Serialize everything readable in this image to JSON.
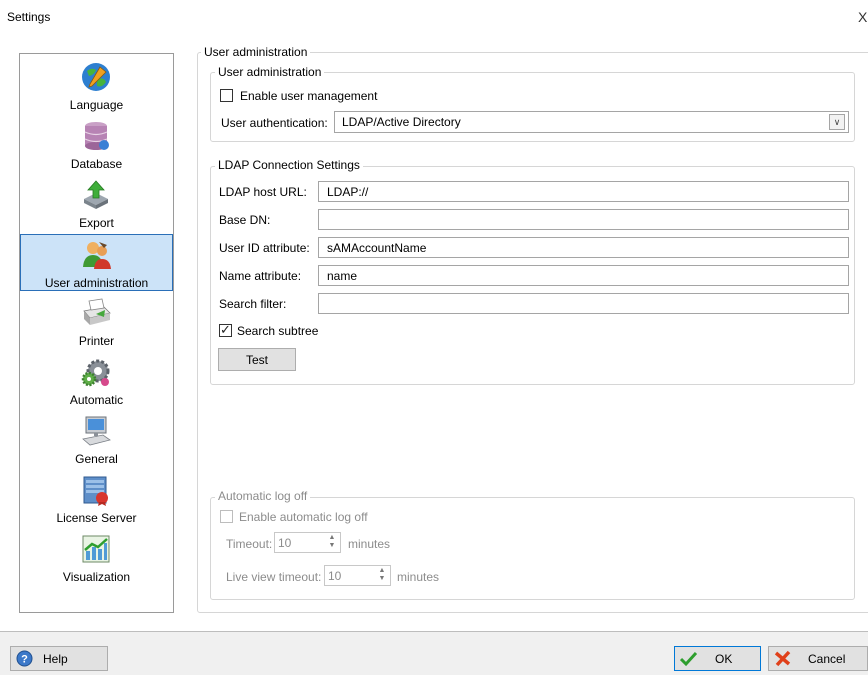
{
  "window": {
    "title": "Settings",
    "close_glyph": "X"
  },
  "nav": {
    "items": [
      {
        "label": "Language",
        "icon": "globe-icon"
      },
      {
        "label": "Database",
        "icon": "database-icon"
      },
      {
        "label": "Export",
        "icon": "export-icon"
      },
      {
        "label": "User administration",
        "icon": "users-icon",
        "selected": true
      },
      {
        "label": "Printer",
        "icon": "printer-icon"
      },
      {
        "label": "Automatic",
        "icon": "gears-icon"
      },
      {
        "label": "General",
        "icon": "computer-icon"
      },
      {
        "label": "License Server",
        "icon": "license-server-icon"
      },
      {
        "label": "Visualization",
        "icon": "chart-icon"
      }
    ]
  },
  "main": {
    "outer_legend": "User administration",
    "user_admin": {
      "legend": "User administration",
      "enable_label": "Enable user management",
      "enable_checked": false,
      "auth_label": "User authentication:",
      "auth_value": "LDAP/Active Directory"
    },
    "ldap": {
      "legend": "LDAP Connection Settings",
      "host_label": "LDAP host URL:",
      "host_value": "LDAP://",
      "base_dn_label": "Base DN:",
      "base_dn_value": "",
      "userid_label": "User ID attribute:",
      "userid_value": "sAMAccountName",
      "name_label": "Name attribute:",
      "name_value": "name",
      "filter_label": "Search filter:",
      "filter_value": "",
      "subtree_label": "Search subtree",
      "subtree_checked": true,
      "test_label": "Test"
    },
    "logoff": {
      "legend": "Automatic log off",
      "enable_label": "Enable automatic log off",
      "timeout_label": "Timeout:",
      "timeout_value": "10",
      "timeout_unit": "minutes",
      "live_label": "Live view timeout:",
      "live_value": "10",
      "live_unit": "minutes"
    }
  },
  "footer": {
    "help_label": "Help",
    "ok_label": "OK",
    "cancel_label": "Cancel"
  },
  "colors": {
    "selection": "#cce3f8",
    "selection_border": "#2a6fb8",
    "ok_check": "#2e9e2e",
    "cancel_x": "#e0401a"
  }
}
